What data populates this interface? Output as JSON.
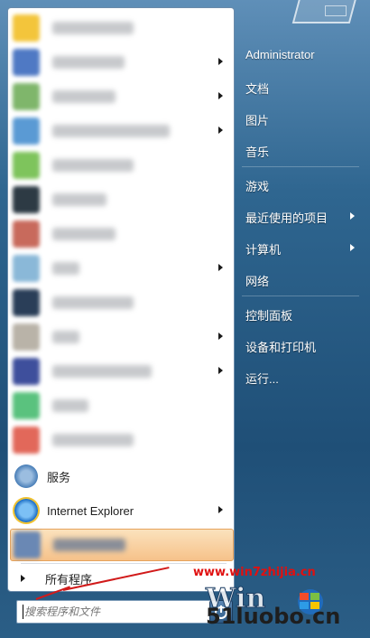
{
  "programs": {
    "items": [
      {
        "name": "pinned-program-1",
        "blurred": true,
        "has_submenu": false,
        "icon_color": "#f3c53b"
      },
      {
        "name": "pinned-program-2",
        "blurred": true,
        "has_submenu": true,
        "icon_color": "#4f79c4"
      },
      {
        "name": "pinned-program-3",
        "blurred": true,
        "has_submenu": true,
        "icon_color": "#7fb66b"
      },
      {
        "name": "pinned-program-4",
        "blurred": true,
        "has_submenu": true,
        "icon_color": "#5a9ad4"
      },
      {
        "name": "pinned-program-5",
        "blurred": true,
        "has_submenu": false,
        "icon_color": "#7ec45c"
      },
      {
        "name": "pinned-program-6",
        "blurred": true,
        "has_submenu": false,
        "icon_color": "#2d3a44"
      },
      {
        "name": "pinned-program-7",
        "blurred": true,
        "has_submenu": false,
        "icon_color": "#c86a5c"
      },
      {
        "name": "pinned-program-8",
        "blurred": true,
        "has_submenu": true,
        "icon_color": "#8ab8d8"
      },
      {
        "name": "pinned-program-9",
        "blurred": true,
        "has_submenu": false,
        "icon_color": "#2a3e58"
      },
      {
        "name": "pinned-program-10",
        "blurred": true,
        "has_submenu": true,
        "icon_color": "#b9b3a8"
      },
      {
        "name": "pinned-program-11",
        "blurred": true,
        "has_submenu": true,
        "icon_color": "#3e4f9c"
      },
      {
        "name": "pinned-program-12",
        "blurred": true,
        "has_submenu": false,
        "icon_color": "#5ac27e"
      },
      {
        "name": "pinned-program-13",
        "blurred": true,
        "has_submenu": false,
        "icon_color": "#e2685a"
      }
    ],
    "services_label": "服务",
    "ie_label": "Internet Explorer",
    "highlighted_blurred": true
  },
  "all_programs_label": "所有程序",
  "search": {
    "placeholder": "搜索程序和文件"
  },
  "right_pane": {
    "user": "Administrator",
    "documents": "文档",
    "pictures": "图片",
    "music": "音乐",
    "games": "游戏",
    "recent": "最近使用的项目",
    "computer": "计算机",
    "network": "网络",
    "control_panel": "控制面板",
    "devices_printers": "设备和打印机",
    "run": "运行..."
  },
  "watermark": {
    "url": "www.win7zhijia.cn",
    "brand": "51luobo.cn"
  },
  "colors": {
    "accent_red": "#e01010",
    "highlight": "#f6c28a"
  }
}
